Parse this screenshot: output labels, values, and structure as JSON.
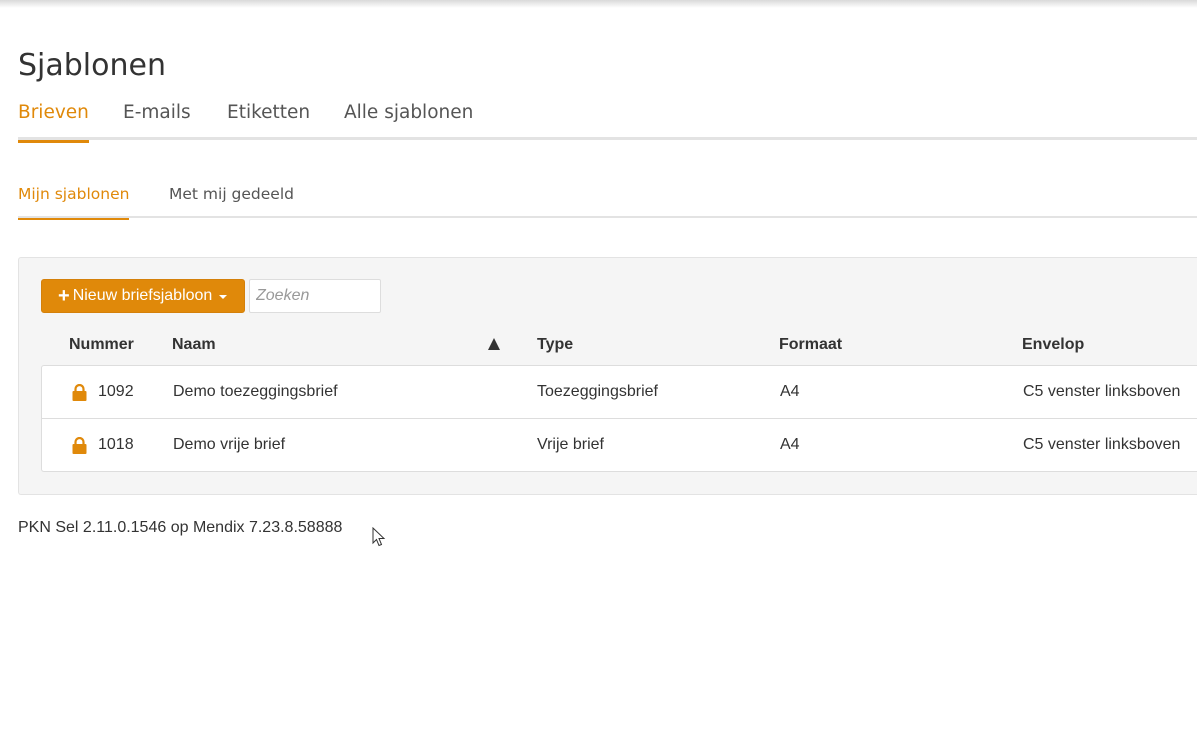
{
  "page": {
    "title": "Sjablonen"
  },
  "main_tabs": [
    {
      "label": "Brieven",
      "active": true
    },
    {
      "label": "E-mails",
      "active": false
    },
    {
      "label": "Etiketten",
      "active": false
    },
    {
      "label": "Alle sjablonen",
      "active": false
    }
  ],
  "sub_tabs": [
    {
      "label": "Mijn sjablonen",
      "active": true
    },
    {
      "label": "Met mij gedeeld",
      "active": false
    }
  ],
  "toolbar": {
    "new_button_label": "Nieuw briefsjabloon",
    "new_button_icon": "plus-icon",
    "new_button_dropdown_icon": "caret-down-icon",
    "search_placeholder": "Zoeken",
    "search_value": ""
  },
  "grid": {
    "columns": [
      "Nummer",
      "Naam",
      "Type",
      "Formaat",
      "Envelop"
    ],
    "sort_column": "Naam",
    "sort_direction": "ascending",
    "sort_icon": "sort-ascending-icon",
    "rows": [
      {
        "icon": "lock-icon",
        "nummer": "1092",
        "naam": "Demo toezeggingsbrief",
        "type": "Toezeggingsbrief",
        "formaat": "A4",
        "envelop": "C5 venster linksboven"
      },
      {
        "icon": "lock-icon",
        "nummer": "1018",
        "naam": "Demo vrije brief",
        "type": "Vrije brief",
        "formaat": "A4",
        "envelop": "C5 venster linksboven"
      }
    ]
  },
  "footer": {
    "version_text": "PKN Sel 2.11.0.1546 op Mendix 7.23.8.58888"
  },
  "colors": {
    "accent": "#e0890a",
    "text": "#333333",
    "muted_text": "#555555",
    "panel_bg": "#f5f5f5",
    "border": "#dddddd"
  }
}
